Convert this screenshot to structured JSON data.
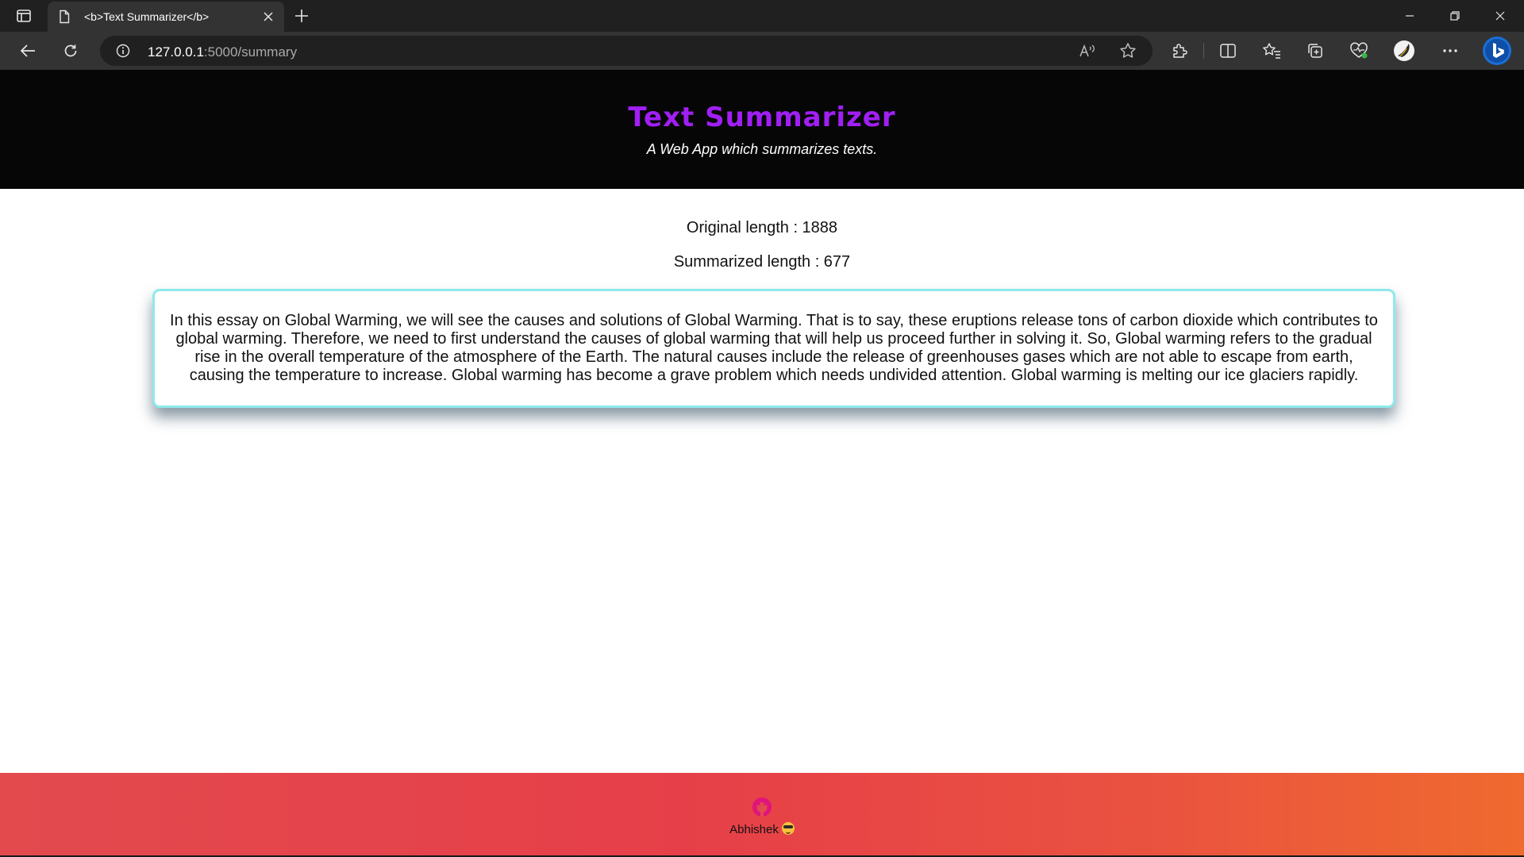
{
  "browser": {
    "tab_title": "<b>Text Summarizer</b>",
    "url_host": "127.0.0.1",
    "url_path": ":5000/summary",
    "icons": {
      "sidebar": "tab-actions-icon",
      "tab": "page-icon",
      "close": "close-icon",
      "new_tab": "plus-icon",
      "back": "back-arrow-icon",
      "reload": "reload-icon",
      "site_info": "info-icon",
      "read_aloud": "read-aloud-icon",
      "favorite": "star-icon",
      "extensions": "puzzle-icon",
      "split": "split-screen-icon",
      "favorites": "favorites-icon",
      "collections": "collections-icon",
      "browser_essentials": "heart-pulse-icon",
      "profile": "profile-icon",
      "more": "more-icon",
      "copilot": "bing-icon"
    }
  },
  "header": {
    "title": "Text Summarizer",
    "subtitle": "A Web App which summarizes texts.",
    "title_color": "#a11ff5",
    "background": "#060606"
  },
  "stats": {
    "original": "Original length : 1888",
    "summarized": "Summarized length : 677"
  },
  "summary": {
    "text": "In this essay on Global Warming, we will see the causes and solutions of Global Warming. That is to say, these eruptions release tons of carbon dioxide which contributes to global warming. Therefore, we need to first understand the causes of global warming that will help us proceed further in solving it. So, Global warming refers to the gradual rise in the overall temperature of the atmosphere of the Earth. The natural causes include the release of greenhouses gases which are not able to escape from earth, causing the temperature to increase. Global warming has become a grave problem which needs undivided attention. Global warming is melting our ice glaciers rapidly.",
    "border_color": "#8ee9ec"
  },
  "footer": {
    "author": "Abhishek",
    "icon": "github-icon",
    "emoji": "sunglasses-emoji",
    "gradient_start": "#e24a4e",
    "gradient_end": "#ef6a2e"
  }
}
